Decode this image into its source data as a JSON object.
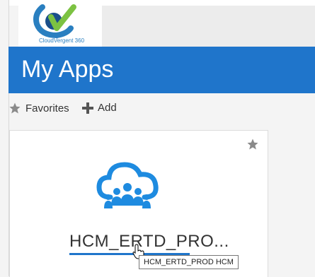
{
  "logo": {
    "text": "CloudVergent 360"
  },
  "banner": {
    "title": "My Apps"
  },
  "toolbar": {
    "favorites_label": "Favorites",
    "add_label": "Add"
  },
  "app_card": {
    "name": "HCM_ERTD_PRO...",
    "tooltip": "HCM_ERTD_PROD HCM",
    "icon": "cloud-people-icon"
  },
  "colors": {
    "brand_blue": "#1f75cb",
    "logo_green": "#7cc242"
  }
}
